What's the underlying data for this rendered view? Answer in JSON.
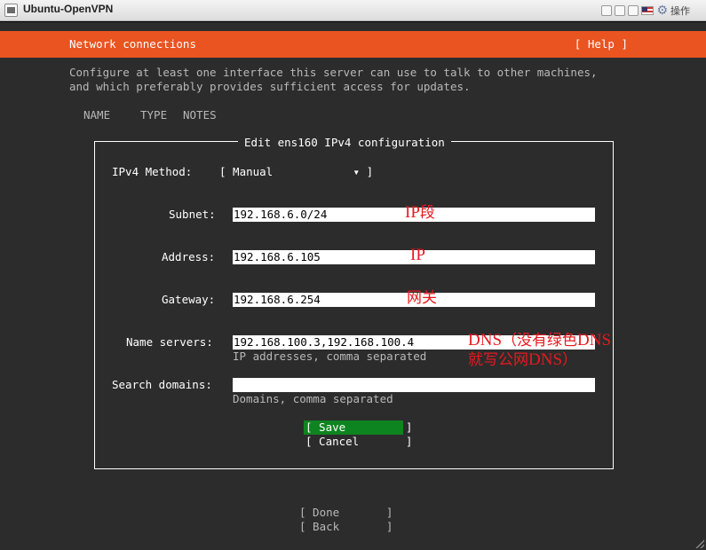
{
  "window": {
    "title": "Ubuntu-OpenVPN",
    "ops_label": "操作",
    "icons": [
      "window-icon",
      "minimize-icon",
      "restore-icon",
      "maximize-icon",
      "flag-icon",
      "gear-icon"
    ]
  },
  "header": {
    "title": "Network connections",
    "help": "[ Help ]"
  },
  "intro": {
    "line1": "Configure at least one interface this server can use to talk to other machines,",
    "line2": "and which preferably provides sufficient access for updates."
  },
  "columns": [
    "NAME",
    "TYPE",
    "NOTES"
  ],
  "dialog": {
    "title": "Edit ens160 IPv4 configuration",
    "method_label": "IPv4 Method:",
    "method_value": "[ Manual            ▾ ]",
    "fields": {
      "subnet": {
        "label": "Subnet:",
        "value": "192.168.6.0/24"
      },
      "address": {
        "label": "Address:",
        "value": "192.168.6.105"
      },
      "gateway": {
        "label": "Gateway:",
        "value": "192.168.6.254"
      },
      "nameservers": {
        "label": "Name servers:",
        "value": "192.168.100.3,192.168.100.4",
        "hint": "IP addresses, comma separated"
      },
      "search_domains": {
        "label": "Search domains:",
        "value": "",
        "hint": "Domains, comma separated"
      }
    },
    "save": "[ Save         ]",
    "cancel": "[ Cancel       ]"
  },
  "footer": {
    "done": "[ Done       ]",
    "back": "[ Back       ]"
  },
  "annotations": {
    "subnet_prefix": "IP",
    "subnet_suffix": "段",
    "address": "IP",
    "gateway": "网关",
    "dns_line1_prefix": "DNS",
    "dns_line1_mid": "（没有绿色",
    "dns_line1_suffix": "DNS",
    "dns_line2_prefix": "就写公网",
    "dns_line2_mid": "DNS",
    "dns_line2_suffix": "）"
  },
  "colors": {
    "accent": "#e95420",
    "background": "#2c2c2c",
    "save_button": "#0e8420",
    "annotation": "#e8191f"
  }
}
